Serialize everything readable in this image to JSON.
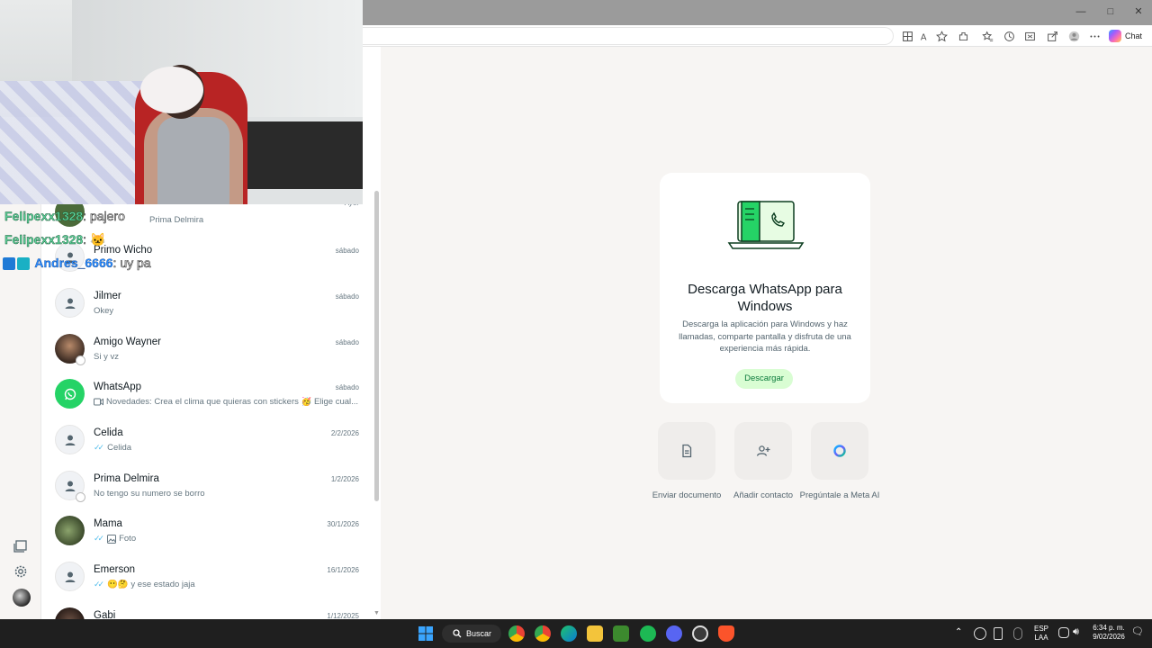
{
  "browser": {
    "chat_label": "Chat",
    "accent": "#25d366"
  },
  "overlay_chat": [
    {
      "user": "Felipexx1328",
      "message": ": pajero"
    },
    {
      "user": "Felipexx1328",
      "message": ": 🐱"
    },
    {
      "user": "Andres_6666",
      "message": ": uy pa"
    }
  ],
  "chats": [
    {
      "name": "",
      "message": "Prima Delmira",
      "time": "Ayer"
    },
    {
      "name": "Primo Wicho",
      "message": "",
      "time": "sábado"
    },
    {
      "name": "Jilmer",
      "message": "Okey",
      "time": "sábado"
    },
    {
      "name": "Amigo Wayner",
      "message": "Si y vz",
      "time": "sábado"
    },
    {
      "name": "WhatsApp",
      "message": "Novedades: Crea el clima que quieras con stickers 🥳 Elige cual...",
      "time": "sábado"
    },
    {
      "name": "Celida",
      "message": "Celida",
      "time": "2/2/2026"
    },
    {
      "name": "Prima Delmira",
      "message": "No tengo su numero se borro",
      "time": "1/2/2026"
    },
    {
      "name": "Mama",
      "message": "Foto",
      "time": "30/1/2026"
    },
    {
      "name": "Emerson",
      "message": "😶🤔 y ese estado jaja",
      "time": "16/1/2026"
    },
    {
      "name": "Gabi",
      "message": "",
      "time": "1/12/2025"
    }
  ],
  "download_card": {
    "title": "Descarga WhatsApp para Windows",
    "description": "Descarga la aplicación para Windows y haz llamadas, comparte pantalla y disfruta de una experiencia más rápida.",
    "button": "Descargar"
  },
  "actions": [
    {
      "label": "Enviar documento",
      "icon": "document-icon"
    },
    {
      "label": "Añadir contacto",
      "icon": "add-contact-icon"
    },
    {
      "label": "Pregúntale a Meta AI",
      "icon": "meta-ai-icon"
    }
  ],
  "taskbar": {
    "search_label": "Buscar",
    "language": "ESP",
    "layout": "LAA",
    "time": "6:34 p. m.",
    "date": "9/02/2026"
  }
}
